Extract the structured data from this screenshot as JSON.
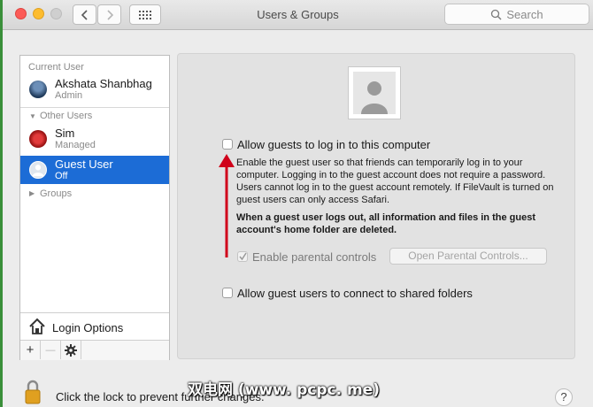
{
  "window": {
    "title": "Users & Groups"
  },
  "toolbar": {
    "search_placeholder": "Search"
  },
  "sidebar": {
    "current_user_header": "Current User",
    "current_user": {
      "name": "Akshata Shanbhag",
      "role": "Admin"
    },
    "other_users_header": "Other Users",
    "other_users": [
      {
        "name": "Sim",
        "role": "Managed"
      },
      {
        "name": "Guest User",
        "role": "Off"
      }
    ],
    "groups_label": "Groups",
    "login_options_label": "Login Options",
    "add_symbol": "+",
    "remove_symbol": "—"
  },
  "main": {
    "allow_guests_label": "Allow guests to log in to this computer",
    "allow_guests_checked": false,
    "description": "Enable the guest user so that friends can temporarily log in to your computer. Logging in to the guest account does not require a password. Users cannot log in to the guest account remotely. If FileVault is turned on guest users can only access Safari.",
    "warning": "When a guest user logs out, all information and files in the guest account's home folder are deleted.",
    "parental_controls_label": "Enable parental controls",
    "parental_controls_checked": true,
    "open_parental_controls_label": "Open Parental Controls...",
    "shared_folders_label": "Allow guest users to connect to shared folders",
    "shared_folders_checked": false
  },
  "footer": {
    "lock_text": "Click the lock to prevent further changes.",
    "watermark": "双电网 (www. pcpc. me)",
    "help_symbol": "?"
  },
  "colors": {
    "selection": "#1c6cd6",
    "arrow": "#d0021b"
  }
}
